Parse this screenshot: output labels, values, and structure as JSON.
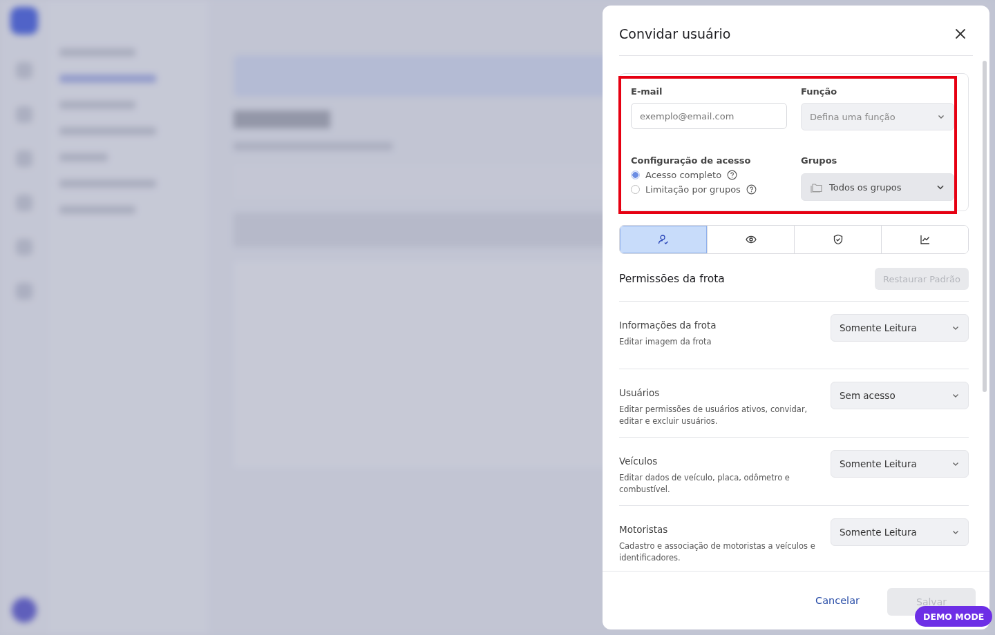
{
  "dialog": {
    "title": "Convidar usuário",
    "form": {
      "email": {
        "label": "E-mail",
        "placeholder": "exemplo@email.com"
      },
      "role": {
        "label": "Função",
        "placeholder": "Defina uma função",
        "disabled": true
      },
      "access": {
        "label": "Configuração de acesso",
        "options": [
          {
            "label": "Acesso completo",
            "selected": true
          },
          {
            "label": "Limitação por grupos",
            "selected": false
          }
        ]
      },
      "groups": {
        "label": "Grupos",
        "value": "Todos os grupos",
        "disabled": true
      }
    },
    "tabs": [
      {
        "kind": "user",
        "selected": true
      },
      {
        "kind": "eye",
        "selected": false
      },
      {
        "kind": "shield",
        "selected": false
      },
      {
        "kind": "chart",
        "selected": false
      }
    ],
    "section": {
      "title": "Permissões da frota",
      "reset_button": {
        "label": "Restaurar Padrão",
        "disabled": true
      }
    },
    "permissions": [
      {
        "name": "Informações da frota",
        "description": "Editar imagem da frota",
        "value": "Somente Leitura"
      },
      {
        "name": "Usuários",
        "description": "Editar permissões de usuários ativos, convidar, editar e excluir usuários.",
        "value": "Sem acesso"
      },
      {
        "name": "Veículos",
        "description": "Editar dados de veículo, placa, odômetro e combustível.",
        "value": "Somente Leitura"
      },
      {
        "name": "Motoristas",
        "description": "Cadastro e associação de motoristas a veículos e identificadores.",
        "value": "Somente Leitura"
      }
    ],
    "footer": {
      "cancel": "Cancelar",
      "save": {
        "label": "Salvar",
        "disabled": true
      }
    }
  },
  "demo_badge": "DEMO MODE"
}
